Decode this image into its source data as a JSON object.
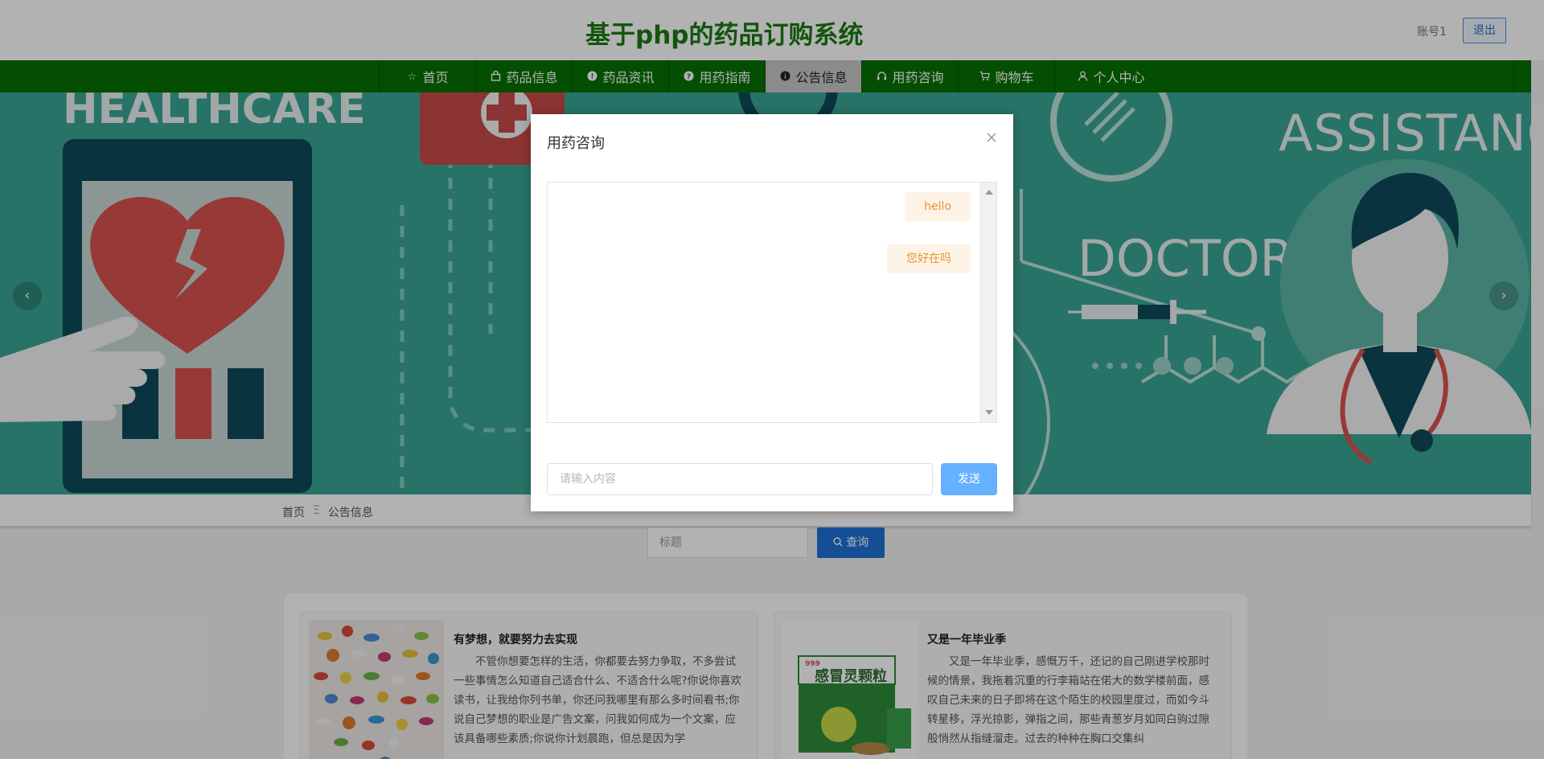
{
  "header": {
    "site_title": "基于php的药品订购系统",
    "account_label": "账号1",
    "logout_label": "退出"
  },
  "nav": {
    "items": [
      {
        "label": "首页",
        "icon": "star-icon"
      },
      {
        "label": "药品信息",
        "icon": "bag-icon"
      },
      {
        "label": "药品资讯",
        "icon": "info-icon"
      },
      {
        "label": "用药指南",
        "icon": "question-icon"
      },
      {
        "label": "公告信息",
        "icon": "info-circle-icon",
        "active": true
      },
      {
        "label": "用药咨询",
        "icon": "headset-icon"
      },
      {
        "label": "购物车",
        "icon": "cart-icon"
      },
      {
        "label": "个人中心",
        "icon": "user-icon"
      }
    ]
  },
  "banner": {
    "text_left": "HEALTHCARE",
    "text_right_top": "ASSISTANCE",
    "text_right_mid": "DOCTORS",
    "prev_icon": "chevron-left-icon",
    "next_icon": "chevron-right-icon"
  },
  "breadcrumb": {
    "home": "首页",
    "separator": "Ξ",
    "current": "公告信息"
  },
  "search": {
    "placeholder": "标题",
    "button_label": "查询"
  },
  "cards": [
    {
      "title": "有梦想，就要努力去实现",
      "text": "不管你想要怎样的生活，你都要去努力争取，不多尝试一些事情怎么知道自己适合什么、不适合什么呢?你说你喜欢读书，让我给你列书单，你还问我哪里有那么多时间看书;你说自己梦想的职业是广告文案，问我如何成为一个文案，应该具备哪些素质;你说你计划晨跑，但总是因为学"
    },
    {
      "title": "又是一年毕业季",
      "image_text": "感冒灵颗粒",
      "image_brand": "999",
      "text": "又是一年毕业季，感慨万千，还记的自己刚进学校那时候的情景，我拖着沉重的行李箱站在偌大的数学楼前面，感叹自己未来的日子即将在这个陌生的校园里度过，而如今斗转星移，浮光掠影，弹指之间，那些青葱岁月如同白驹过隙般悄然从指缝溜走。过去的种种在胸口交集纠"
    }
  ],
  "modal": {
    "title": "用药咨询",
    "messages": [
      "hello",
      "您好在吗"
    ],
    "input_placeholder": "请输入内容",
    "send_label": "发送"
  },
  "colors": {
    "brand_green": "#057000",
    "title_green": "#1a7a14",
    "banner_teal": "#3aa594",
    "send_blue": "#66b1ff",
    "message_orange": "#e79533"
  }
}
